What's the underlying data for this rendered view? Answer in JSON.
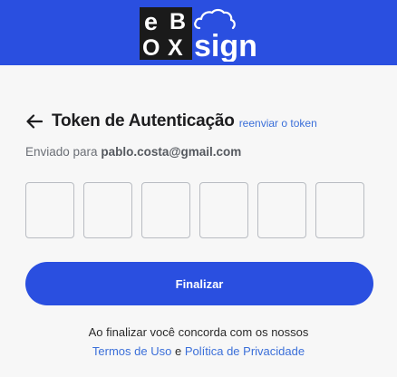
{
  "brand": {
    "logo_letters": [
      "e",
      "B",
      "O",
      "X"
    ],
    "logo_word": "sign",
    "header_color": "#2a4fe0",
    "accent_color": "#3b6fd9"
  },
  "page": {
    "back_icon": "arrow-left-icon",
    "title": "Token de Autenticação",
    "resend_label": "reenviar o token",
    "sent_prefix": "Enviado para",
    "email": "pablo.costa@gmail.com"
  },
  "code_inputs": [
    "",
    "",
    "",
    "",
    "",
    ""
  ],
  "actions": {
    "finish_label": "Finalizar"
  },
  "terms": {
    "intro": "Ao finalizar você concorda com os nossos",
    "terms_label": "Termos de Uso",
    "connector": "e",
    "privacy_label": "Política de Privacidade"
  }
}
